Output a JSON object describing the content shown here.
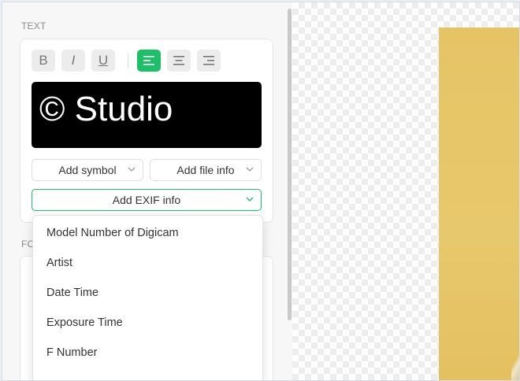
{
  "text_section": {
    "label": "TEXT",
    "format_buttons": [
      {
        "name": "bold",
        "glyph": "B"
      },
      {
        "name": "italic",
        "glyph": "I"
      },
      {
        "name": "underline",
        "glyph": "U"
      }
    ],
    "align_active": "left",
    "preview_text": "© Studio",
    "add_symbol_label": "Add symbol",
    "add_file_info_label": "Add file info",
    "add_exif_label": "Add EXIF info"
  },
  "second_section": {
    "label_partial": "FO"
  },
  "exif_dropdown": {
    "options": [
      "Model Number of Digicam",
      "Artist",
      "Date Time",
      "Exposure Time",
      "F Number"
    ]
  },
  "colors": {
    "accent": "#1fbf6a",
    "photo": "#e6c466"
  }
}
